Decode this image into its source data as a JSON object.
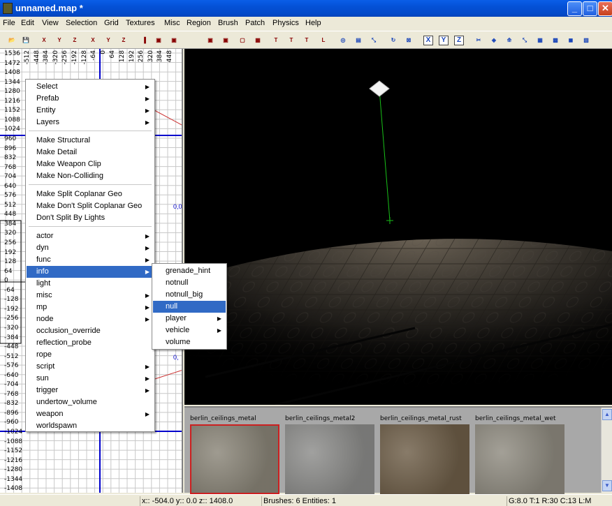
{
  "window": {
    "title": "unnamed.map *",
    "minimize": "_",
    "maximize": "□",
    "close": "✕"
  },
  "menubar": [
    "File",
    "Edit",
    "View",
    "Selection",
    "Grid",
    "Textures",
    "Misc",
    "Region",
    "Brush",
    "Patch",
    "Physics",
    "Help"
  ],
  "toolbar": {
    "buttons": [
      {
        "icon": "open-folder-icon",
        "glyph": "📂"
      },
      {
        "icon": "save-disk-icon",
        "glyph": "💾"
      },
      {
        "icon": "flip-x-icon",
        "glyph": "X"
      },
      {
        "icon": "flip-y-icon",
        "glyph": "Y"
      },
      {
        "icon": "flip-z-icon",
        "glyph": "Z"
      },
      {
        "icon": "rotate-x-icon",
        "glyph": "X"
      },
      {
        "icon": "rotate-y-icon",
        "glyph": "Y"
      },
      {
        "icon": "rotate-z-icon",
        "glyph": "Z"
      },
      {
        "icon": "select-complete-tall-icon",
        "glyph": "▌"
      },
      {
        "icon": "select-touching-icon",
        "glyph": "▣"
      },
      {
        "icon": "select-partial-icon",
        "glyph": "▢"
      },
      {
        "icon": "select-inside-icon",
        "glyph": "▦"
      },
      {
        "icon": "tex-fit-icon",
        "glyph": "T"
      },
      {
        "icon": "tex-flip-icon",
        "glyph": "T"
      },
      {
        "icon": "tex-rotate-icon",
        "glyph": "T"
      },
      {
        "icon": "cycle-layer-icon",
        "glyph": "L"
      },
      {
        "icon": "camera-view-icon",
        "glyph": "◎"
      },
      {
        "icon": "view-change-icon",
        "glyph": "▤"
      },
      {
        "icon": "view-xy-icon",
        "glyph": "⤡"
      },
      {
        "icon": "rotate-tool-icon",
        "glyph": "↻"
      },
      {
        "icon": "scale-tool-icon",
        "glyph": "⊠"
      },
      {
        "icon": "scale-axis-icon",
        "glyph": "⊡"
      },
      {
        "icon": "lock-x-icon",
        "glyph": "X"
      },
      {
        "icon": "lock-y-icon",
        "glyph": "Y"
      },
      {
        "icon": "lock-z-icon",
        "glyph": "Z"
      },
      {
        "icon": "cubic-clip-icon",
        "glyph": "✂"
      },
      {
        "icon": "texture-lock-icon",
        "glyph": "◈"
      },
      {
        "icon": "drag-edges-icon",
        "glyph": "⟰"
      },
      {
        "icon": "vertex-edit-icon",
        "glyph": "⤡"
      },
      {
        "icon": "show-patch-icon",
        "glyph": "▦"
      },
      {
        "icon": "patch-tool-icon",
        "glyph": "▩"
      },
      {
        "icon": "entity-tool-icon",
        "glyph": "◼"
      },
      {
        "icon": "prefab-tool-icon",
        "glyph": "▧"
      }
    ]
  },
  "grid": {
    "y_labels": [
      "1536",
      "1472",
      "1408",
      "1344",
      "1280",
      "1216",
      "1152",
      "1088",
      "1024",
      "960",
      "896",
      "832",
      "768",
      "704",
      "640",
      "576",
      "512",
      "448",
      "384",
      "320",
      "256",
      "192",
      "128",
      "64",
      "0",
      "-64",
      "-128",
      "-192",
      "-256",
      "-320",
      "-384",
      "-448",
      "-512",
      "-576",
      "-640",
      "-704",
      "-768",
      "-832",
      "-896",
      "-960",
      "-1024",
      "-1088",
      "-1152",
      "-1216",
      "-1280",
      "-1344",
      "-1408"
    ],
    "x_labels": [
      "-512",
      "-448",
      "-384",
      "-320",
      "-256",
      "-192",
      "-128",
      "-64",
      "0",
      "64",
      "128",
      "192",
      "256",
      "320",
      "384",
      "448"
    ],
    "edge_values": [
      "0,0",
      "0,"
    ]
  },
  "context_menu": {
    "groups": [
      [
        {
          "label": "Select",
          "submenu": true
        },
        {
          "label": "Prefab",
          "submenu": true
        },
        {
          "label": "Entity",
          "submenu": true
        },
        {
          "label": "Layers",
          "submenu": true
        }
      ],
      [
        {
          "label": "Make Structural"
        },
        {
          "label": "Make Detail"
        },
        {
          "label": "Make Weapon Clip"
        },
        {
          "label": "Make Non-Colliding"
        }
      ],
      [
        {
          "label": "Make Split Coplanar Geo"
        },
        {
          "label": "Make Don't Split Coplanar Geo"
        },
        {
          "label": "Don't Split By Lights"
        }
      ],
      [
        {
          "label": "actor",
          "submenu": true
        },
        {
          "label": "dyn",
          "submenu": true
        },
        {
          "label": "func",
          "submenu": true
        },
        {
          "label": "info",
          "submenu": true,
          "highlighted": true
        },
        {
          "label": "light"
        },
        {
          "label": "misc",
          "submenu": true
        },
        {
          "label": "mp",
          "submenu": true
        },
        {
          "label": "node",
          "submenu": true
        },
        {
          "label": "occlusion_override"
        },
        {
          "label": "reflection_probe"
        },
        {
          "label": "rope"
        },
        {
          "label": "script",
          "submenu": true
        },
        {
          "label": "sun",
          "submenu": true
        },
        {
          "label": "trigger",
          "submenu": true
        },
        {
          "label": "undertow_volume"
        },
        {
          "label": "weapon",
          "submenu": true
        },
        {
          "label": "worldspawn"
        }
      ]
    ]
  },
  "info_submenu": [
    {
      "label": "grenade_hint"
    },
    {
      "label": "notnull"
    },
    {
      "label": "notnull_big"
    },
    {
      "label": "null",
      "highlighted": true
    },
    {
      "label": "player",
      "submenu": true
    },
    {
      "label": "vehicle",
      "submenu": true
    },
    {
      "label": "volume"
    }
  ],
  "textures": [
    {
      "name": "berlin_ceilings_metal",
      "selected": true,
      "color": "#8a8578"
    },
    {
      "name": "berlin_ceilings_metal2",
      "color": "#8c8c8a"
    },
    {
      "name": "berlin_ceilings_metal_rust",
      "color": "#6e5e48"
    },
    {
      "name": "berlin_ceilings_metal_wet",
      "color": "#8f8b80"
    }
  ],
  "statusbar": {
    "coords": "x:: -504.0  y:: 0.0  z:: 1408.0",
    "counts": "Brushes: 6 Entities: 1",
    "grid_info": "G:8.0 T:1 R:30 C:13 L:M"
  },
  "colors": {
    "grid_axis": "#0000cc",
    "grid_line": "#c8c8c8",
    "menu_highlight": "#316ac5",
    "selected_texture_border": "#cc2020"
  }
}
